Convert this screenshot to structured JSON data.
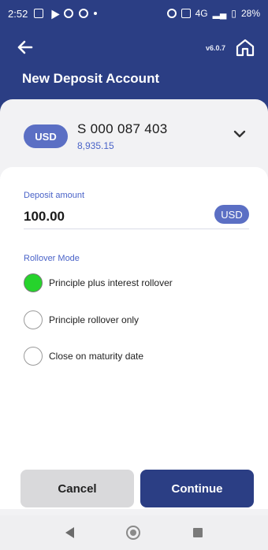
{
  "status_bar": {
    "time": "2:52",
    "network": "4G",
    "battery": "28%"
  },
  "header": {
    "title": "New Deposit Account",
    "version": "v6.0.7"
  },
  "account": {
    "currency": "USD",
    "number": "S 000 087 403",
    "balance": "8,935.15"
  },
  "deposit": {
    "label": "Deposit amount",
    "amount": "100.00",
    "currency": "USD"
  },
  "rollover": {
    "label": "Rollover Mode",
    "options": [
      {
        "label": "Principle plus interest rollover",
        "selected": true
      },
      {
        "label": "Principle rollover only",
        "selected": false
      },
      {
        "label": "Close on maturity date",
        "selected": false
      }
    ]
  },
  "buttons": {
    "cancel": "Cancel",
    "continue": "Continue"
  },
  "colors": {
    "primary": "#2b3e84",
    "accent": "#5b6fc4",
    "link": "#4a63c8",
    "selected_radio": "#26d32c"
  },
  "icons": {
    "back": "arrow-left-icon",
    "home": "home-icon",
    "expand": "chevron-down-icon"
  }
}
